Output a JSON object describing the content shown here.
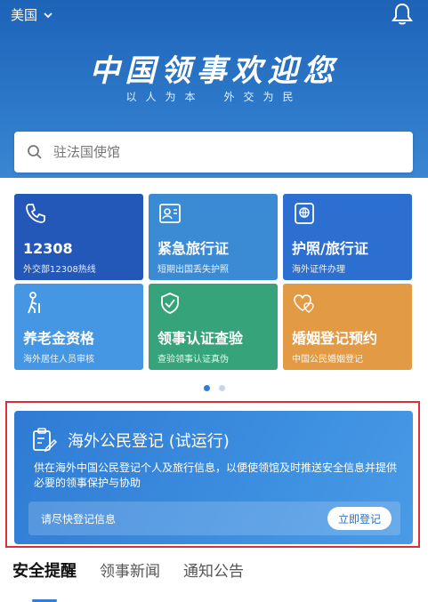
{
  "header": {
    "region": "美国",
    "title": "中国领事欢迎您",
    "subtitle": "以人为本　外交为民"
  },
  "search": {
    "placeholder": "驻法国使馆"
  },
  "services": [
    {
      "title": "12308",
      "subtitle": "外交部12308热线",
      "icon": "phone-icon",
      "color": "#2458b8"
    },
    {
      "title": "紧急旅行证",
      "subtitle": "短期出国丢失护照",
      "icon": "id-card-icon",
      "color": "#3a8ad4"
    },
    {
      "title": "护照/旅行证",
      "subtitle": "海外证件办理",
      "icon": "globe-icon",
      "color": "#2d6fd0"
    },
    {
      "title": "养老金资格",
      "subtitle": "海外居住人员审核",
      "icon": "elderly-icon",
      "color": "#4596e3"
    },
    {
      "title": "领事认证查验",
      "subtitle": "查验领事认证真伪",
      "icon": "shield-check-icon",
      "color": "#36a37a"
    },
    {
      "title": "婚姻登记预约",
      "subtitle": "中国公民婚姻登记",
      "icon": "hearts-icon",
      "color": "#e39a45"
    }
  ],
  "registration": {
    "title": "海外公民登记 (试运行)",
    "description": "供在海外中国公民登记个人及旅行信息，以便使领馆及时推送安全信息并提供必要的领事保护与协助",
    "hint": "请尽快登记信息",
    "button": "立即登记"
  },
  "tabs": [
    {
      "label": "安全提醒",
      "active": true
    },
    {
      "label": "领事新闻",
      "active": false
    },
    {
      "label": "通知公告",
      "active": false
    }
  ]
}
